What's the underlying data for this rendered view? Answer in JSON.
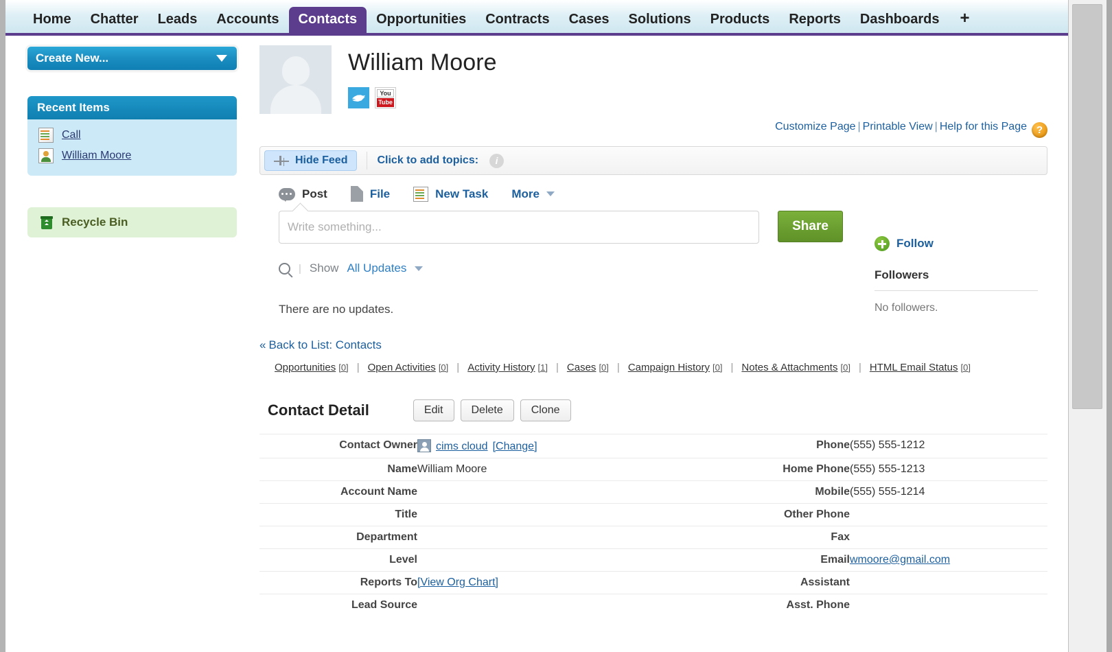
{
  "tabs": [
    {
      "label": "Home",
      "active": false
    },
    {
      "label": "Chatter",
      "active": false
    },
    {
      "label": "Leads",
      "active": false
    },
    {
      "label": "Accounts",
      "active": false
    },
    {
      "label": "Contacts",
      "active": true
    },
    {
      "label": "Opportunities",
      "active": false
    },
    {
      "label": "Contracts",
      "active": false
    },
    {
      "label": "Cases",
      "active": false
    },
    {
      "label": "Solutions",
      "active": false
    },
    {
      "label": "Products",
      "active": false
    },
    {
      "label": "Reports",
      "active": false
    },
    {
      "label": "Dashboards",
      "active": false
    }
  ],
  "tab_add_label": "+",
  "sidebar": {
    "create_new_label": "Create New...",
    "recent_items_header": "Recent Items",
    "recent_items": [
      {
        "label": "Call",
        "icon": "task-icon"
      },
      {
        "label": "William Moore",
        "icon": "contact-icon"
      }
    ],
    "recycle_bin_label": "Recycle Bin"
  },
  "record": {
    "name": "William Moore",
    "social": [
      {
        "name": "twitter-icon",
        "top": "",
        "bottom": ""
      },
      {
        "name": "youtube-icon",
        "top": "You",
        "bottom": "Tube"
      }
    ]
  },
  "page_links": {
    "customize": "Customize Page",
    "printable": "Printable View",
    "help": "Help for this Page",
    "separator": "|",
    "help_badge": "?"
  },
  "feedbar": {
    "hide_feed_label": "Hide Feed",
    "add_topics_label": "Click to add topics:",
    "info_badge": "i"
  },
  "publisher": {
    "tabs": [
      {
        "label": "Post",
        "icon": "post-icon",
        "selected": true
      },
      {
        "label": "File",
        "icon": "file-icon",
        "selected": false
      },
      {
        "label": "New Task",
        "icon": "task-icon",
        "selected": false
      },
      {
        "label": "More",
        "icon": "caret-down-icon",
        "selected": false
      }
    ],
    "write_placeholder": "Write something...",
    "share_label": "Share"
  },
  "follow": {
    "follow_label": "Follow",
    "followers_header": "Followers",
    "no_followers": "No followers."
  },
  "feed_filter": {
    "show_label": "Show",
    "show_value": "All Updates"
  },
  "feed_empty": "There are no updates.",
  "back_to_list": {
    "chevron": "«",
    "label": "Back to List: Contacts"
  },
  "related_links": [
    {
      "label": "Opportunities",
      "count": "[0]"
    },
    {
      "label": "Open Activities",
      "count": "[0]"
    },
    {
      "label": "Activity History",
      "count": "[1]"
    },
    {
      "label": "Cases",
      "count": "[0]"
    },
    {
      "label": "Campaign History",
      "count": "[0]"
    },
    {
      "label": "Notes & Attachments",
      "count": "[0]"
    },
    {
      "label": "HTML Email Status",
      "count": "[0]"
    }
  ],
  "detail": {
    "title": "Contact Detail",
    "buttons": [
      {
        "label": "Edit"
      },
      {
        "label": "Delete"
      },
      {
        "label": "Clone"
      }
    ],
    "rows": [
      {
        "left_label": "Contact Owner",
        "left_value": "cims cloud",
        "left_value_is_link": true,
        "left_extra": "[Change]",
        "left_icon": "user-icon",
        "right_label": "Phone",
        "right_value": "(555) 555-1212"
      },
      {
        "left_label": "Name",
        "left_value": "William Moore",
        "right_label": "Home Phone",
        "right_value": "(555) 555-1213"
      },
      {
        "left_label": "Account Name",
        "left_value": "",
        "right_label": "Mobile",
        "right_value": "(555) 555-1214"
      },
      {
        "left_label": "Title",
        "left_value": "",
        "right_label": "Other Phone",
        "right_value": ""
      },
      {
        "left_label": "Department",
        "left_value": "",
        "right_label": "Fax",
        "right_value": ""
      },
      {
        "left_label": "Level",
        "left_value": "",
        "right_label": "Email",
        "right_value": "wmoore@gmail.com",
        "right_value_is_link": true
      },
      {
        "left_label": "Reports To",
        "left_value": "[View Org Chart]",
        "left_value_is_link": true,
        "right_label": "Assistant",
        "right_value": ""
      },
      {
        "left_label": "Lead Source",
        "left_value": "",
        "right_label": "Asst. Phone",
        "right_value": ""
      }
    ]
  },
  "colors": {
    "active_tab": "#5c3c8c",
    "link": "#1c5f9e",
    "share_button": "#6fa32f",
    "sidebar_header": "#0f7fb0",
    "recent_bg": "#cbe9f7",
    "recycle_bg": "#dff2d6"
  }
}
